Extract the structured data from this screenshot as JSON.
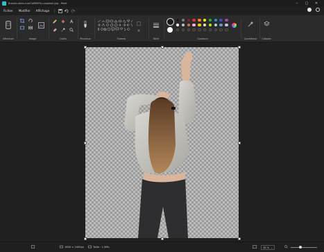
{
  "window": {
    "title": "thando-obiio-marCaMWYfs-unsplash.jpg - Paint",
    "min": "–",
    "max": "▢",
    "close": "✕"
  },
  "menu": {
    "file": "Fichier",
    "edit": "Modifier",
    "view": "Affichage"
  },
  "ribbon": {
    "selection": "Sélection",
    "image": "Image",
    "tools": "Outils",
    "brushes": "Pinceaux",
    "shapes": "Formes",
    "size": "Taille",
    "colors": "Couleurs",
    "copilot": "Cocréateur",
    "layers": "Calques",
    "text_tool": "A",
    "palette": [
      "#1a1a1a",
      "#7f7f7f",
      "#8b1c1c",
      "#e0322f",
      "#ff7f27",
      "#fff200",
      "#22b14c",
      "#1d9ad6",
      "#3f48cc",
      "#a349a4",
      "#ffffff",
      "#c3c3c3",
      "#b97a57",
      "#ffaec9",
      "#ffc90e",
      "#efe4b0",
      "#b5e61d",
      "#99d9ea",
      "#7092be",
      "#c8bfe7"
    ],
    "custom_palette_count": 10
  },
  "status": {
    "dimensions": "1600 × 2400px",
    "filesize": "Taille : 1,9Mo",
    "zoom": "38 %",
    "zoom_fraction": 0.36
  }
}
